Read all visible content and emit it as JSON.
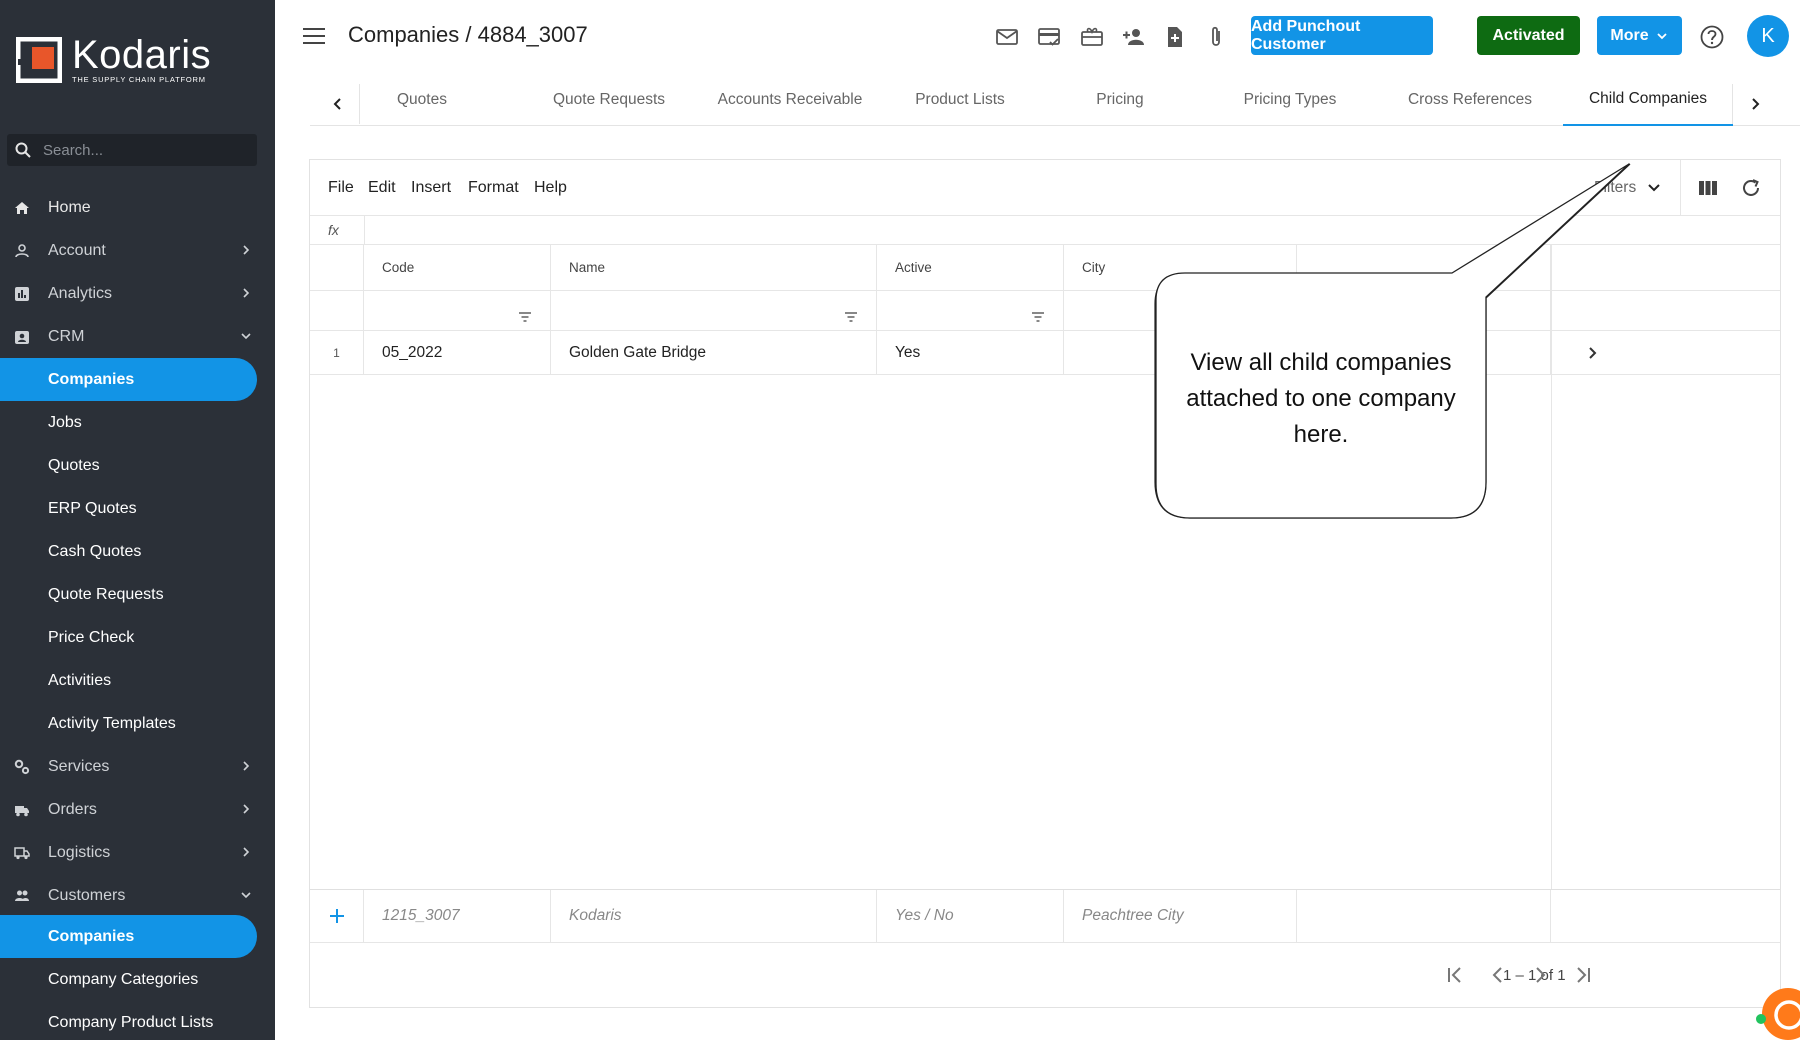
{
  "sidebar": {
    "logo_name": "Kodaris",
    "logo_tagline": "THE SUPPLY CHAIN PLATFORM",
    "search_placeholder": "Search...",
    "items": [
      {
        "label": "Home",
        "icon": "home-icon"
      },
      {
        "label": "Account",
        "icon": "user-icon"
      },
      {
        "label": "Analytics",
        "icon": "analytics-icon"
      },
      {
        "label": "CRM",
        "icon": "crm-icon"
      },
      {
        "label": "Companies"
      },
      {
        "label": "Jobs"
      },
      {
        "label": "Quotes"
      },
      {
        "label": "ERP Quotes"
      },
      {
        "label": "Cash Quotes"
      },
      {
        "label": "Quote Requests"
      },
      {
        "label": "Price Check"
      },
      {
        "label": "Activities"
      },
      {
        "label": "Activity Templates"
      },
      {
        "label": "Services",
        "icon": "services-icon"
      },
      {
        "label": "Orders",
        "icon": "truck-icon"
      },
      {
        "label": "Logistics",
        "icon": "logistics-icon"
      },
      {
        "label": "Customers",
        "icon": "customers-icon"
      },
      {
        "label": "Companies"
      },
      {
        "label": "Company Categories"
      },
      {
        "label": "Company Product Lists"
      }
    ]
  },
  "header": {
    "title": "Companies / 4884_3007",
    "add_punchout_label": "Add Punchout Customer",
    "activated_label": "Activated",
    "more_label": "More",
    "avatar_initial": "K"
  },
  "tabs": [
    {
      "label": "Quotes"
    },
    {
      "label": "Quote Requests"
    },
    {
      "label": "Accounts Receivable"
    },
    {
      "label": "Product Lists"
    },
    {
      "label": "Pricing"
    },
    {
      "label": "Pricing Types"
    },
    {
      "label": "Cross References"
    },
    {
      "label": "Child Companies",
      "active": true
    }
  ],
  "toolbar": {
    "menus": [
      "File",
      "Edit",
      "Insert",
      "Format",
      "Help"
    ],
    "filters_label": "Filters",
    "fx_label": "fx"
  },
  "table": {
    "columns": [
      "Code",
      "Name",
      "Active",
      "City"
    ],
    "rows": [
      {
        "num": "1",
        "code": "05_2022",
        "name": "Golden Gate Bridge",
        "active": "Yes",
        "city": ""
      }
    ],
    "new_row_placeholders": {
      "code": "1215_3007",
      "name": "Kodaris",
      "active": "Yes / No",
      "city": "Peachtree City"
    }
  },
  "pager": {
    "range_text": "1 – 1 of 1"
  },
  "callout": {
    "text": "View all child companies attached to one company here."
  },
  "colors": {
    "sidebar_bg": "#2b3038",
    "accent": "#1294e6",
    "activated": "#0e6b12",
    "logo_orange": "#e8562a"
  }
}
